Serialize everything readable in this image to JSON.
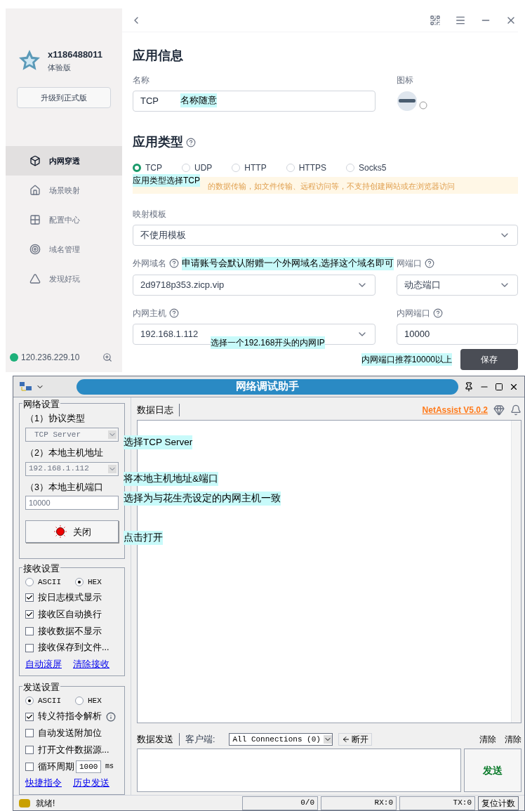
{
  "top_app": {
    "sidebar": {
      "username": "x1186488011",
      "plan": "体验版",
      "upgrade_button": "升级到正式版",
      "nav": [
        {
          "label": "内网穿透",
          "selected": true,
          "kind": "cube"
        },
        {
          "label": "场景映射",
          "selected": false,
          "kind": "scene"
        },
        {
          "label": "配置中心",
          "selected": false,
          "kind": "grid"
        },
        {
          "label": "域名管理",
          "selected": false,
          "kind": "target"
        },
        {
          "label": "发现好玩",
          "selected": false,
          "kind": "triangle"
        }
      ],
      "ip": "120.236.229.10"
    },
    "info": {
      "title": "应用信息",
      "name_label": "名称",
      "name_value": "TCP",
      "name_note": "名称随意",
      "icon_label": "图标"
    },
    "type": {
      "title": "应用类型",
      "options": [
        {
          "label": "TCP",
          "selected": true
        },
        {
          "label": "UDP",
          "selected": false
        },
        {
          "label": "HTTP",
          "selected": false
        },
        {
          "label": "HTTPS",
          "selected": false
        },
        {
          "label": "Socks5",
          "selected": false
        }
      ],
      "note": "应用类型选择TCP",
      "warning": "的数据传输，如文件传输、远程访问等，不支持创建网站或在浏览器访问"
    },
    "template": {
      "label": "映射模板",
      "value": "不使用模板"
    },
    "domain": {
      "label": "外网域名",
      "note": "申请账号会默认附赠一个外网域名,选择这个域名即可",
      "value": "2d9718p353.zicp.vip"
    },
    "public_port": {
      "label": "网端口",
      "value": "动态端口"
    },
    "host": {
      "label": "内网主机",
      "value": "192.168.1.112",
      "note": "选择一个192.168开头的内网IP"
    },
    "local_port": {
      "label": "内网端口",
      "value": "10000"
    },
    "save_note": "内网端口推荐10000以上",
    "save_button": "保存"
  },
  "net_assist": {
    "title": "网络调试助手",
    "network": {
      "title": "网络设置",
      "protocol_label": "（1）协议类型",
      "protocol": "TCP Server",
      "address_label": "（2）本地主机地址",
      "address": "192.168.1.112",
      "port_label": "（3）本地主机端口",
      "port": "10000",
      "toggle_button": "关闭"
    },
    "notes": [
      "选择TCP Server",
      "将本地主机地址&端口",
      "选择为与花生壳设定的内网主机一致",
      "点击打开"
    ],
    "receive": {
      "title": "接收设置",
      "formats": [
        {
          "label": "ASCII",
          "selected": false
        },
        {
          "label": "HEX",
          "selected": true
        }
      ],
      "options": [
        {
          "label": "按日志模式显示",
          "checked": true,
          "kind": "plain"
        },
        {
          "label": "接收区自动换行",
          "checked": true,
          "kind": "plain"
        },
        {
          "label": "接收数据不显示",
          "checked": false,
          "kind": "plain"
        },
        {
          "label": "接收保存到文件...",
          "checked": false,
          "kind": "plain"
        }
      ],
      "links": [
        "自动滚屏",
        "清除接收"
      ]
    },
    "send": {
      "title": "发送设置",
      "formats": [
        {
          "label": "ASCII",
          "selected": true
        },
        {
          "label": "HEX",
          "selected": false
        }
      ],
      "options": [
        {
          "label": "转义符指令解析",
          "checked": true,
          "kind": "info"
        },
        {
          "label": "自动发送附加位",
          "checked": false,
          "kind": "plain"
        },
        {
          "label": "打开文件数据源...",
          "checked": false,
          "kind": "plain"
        },
        {
          "label": "循环周期",
          "checked": false,
          "kind": "period",
          "value": "1000",
          "unit": "ms"
        }
      ],
      "links": [
        "快捷指令",
        "历史发送"
      ]
    },
    "log_tab": "数据日志",
    "version_link": "NetAssist V5.0.2",
    "send_bar": {
      "tab": "数据发送",
      "client_label": "客户端:",
      "client_select": "All Connections (0)",
      "disconnect_button": "断开",
      "clear_buttons": [
        "清除",
        "清除"
      ],
      "send_button": "发送"
    },
    "status": {
      "message": "就绪!",
      "cells": [
        "0/0",
        "RX:0",
        "TX:0"
      ],
      "reset_button": "复位计数"
    }
  }
}
